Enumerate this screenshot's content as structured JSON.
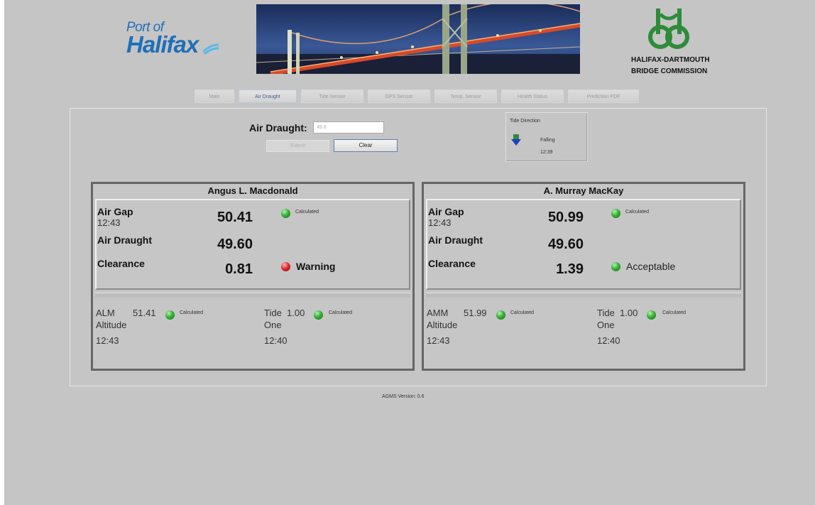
{
  "header": {
    "port_logo_line1": "Port of",
    "port_logo_line2": "Halifax",
    "commission_line1": "HALIFAX-DARTMOUTH",
    "commission_line2": "BRIDGE COMMISSION"
  },
  "tabs": [
    {
      "label": "Main",
      "active": false
    },
    {
      "label": "Air Draught",
      "active": true
    },
    {
      "label": "Tide Sensor",
      "active": false
    },
    {
      "label": "GPS Sensor",
      "active": false
    },
    {
      "label": "Temp. Sensor",
      "active": false
    },
    {
      "label": "Health Status",
      "active": false
    },
    {
      "label": "Prediction PDF",
      "active": false
    }
  ],
  "form": {
    "label": "Air Draught:",
    "input_value": "49.6",
    "submit_label": "Submit",
    "clear_label": "Clear"
  },
  "tide": {
    "title": "Tide Direction",
    "state": "Falling",
    "time": "12:39"
  },
  "bridges": [
    {
      "name": "Angus L. Macdonald",
      "air_gap_label": "Air Gap",
      "air_gap_time": "12:43",
      "air_gap_value": "50.41",
      "air_gap_status": "Calculated",
      "air_draught_label": "Air Draught",
      "air_draught_value": "49.60",
      "clearance_label": "Clearance",
      "clearance_value": "0.81",
      "clearance_status": "Warning",
      "alt_code": "ALM",
      "alt_word": "Altitude",
      "alt_value": "51.41",
      "alt_status": "Calculated",
      "alt_time": "12:43",
      "tide_label": "Tide",
      "tide_word": "One",
      "tide_value": "1.00",
      "tide_status": "Calculated",
      "tide_time": "12:40"
    },
    {
      "name": "A. Murray MacKay",
      "air_gap_label": "Air Gap",
      "air_gap_time": "12:43",
      "air_gap_value": "50.99",
      "air_gap_status": "Calculated",
      "air_draught_label": "Air Draught",
      "air_draught_value": "49.60",
      "clearance_label": "Clearance",
      "clearance_value": "1.39",
      "clearance_status": "Acceptable",
      "alt_code": "AMM",
      "alt_word": "Altitude",
      "alt_value": "51.99",
      "alt_status": "Calculated",
      "alt_time": "12:43",
      "tide_label": "Tide",
      "tide_word": "One",
      "tide_value": "1.00",
      "tide_status": "Calculated",
      "tide_time": "12:40"
    }
  ],
  "footer": {
    "version": "AGMS Version: 0.6"
  },
  "colors": {
    "page_bg": "#c5c5c5",
    "status_ok": "#36b236",
    "status_warning": "#e22c2c",
    "logo_blue": "#1f6fb8",
    "commission_green": "#2e8b3a"
  }
}
